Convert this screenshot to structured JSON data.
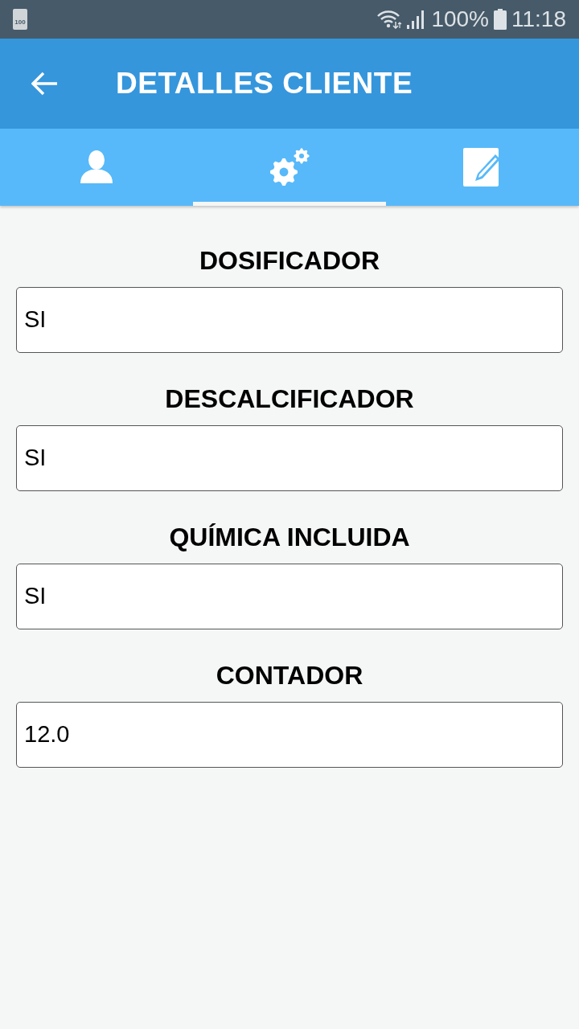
{
  "status_bar": {
    "notification_text": "100",
    "battery": "100%",
    "time": "11:18"
  },
  "app_bar": {
    "title": "DETALLES CLIENTE"
  },
  "tabs": [
    {
      "kind": "person",
      "selected": false
    },
    {
      "kind": "gears",
      "selected": true
    },
    {
      "kind": "edit",
      "selected": false
    }
  ],
  "fields": [
    {
      "label": "DOSIFICADOR",
      "value": "SI"
    },
    {
      "label": "DESCALCIFICADOR",
      "value": "SI"
    },
    {
      "label": "QUÍMICA INCLUIDA",
      "value": "SI"
    },
    {
      "label": "CONTADOR",
      "value": "12.0"
    }
  ]
}
